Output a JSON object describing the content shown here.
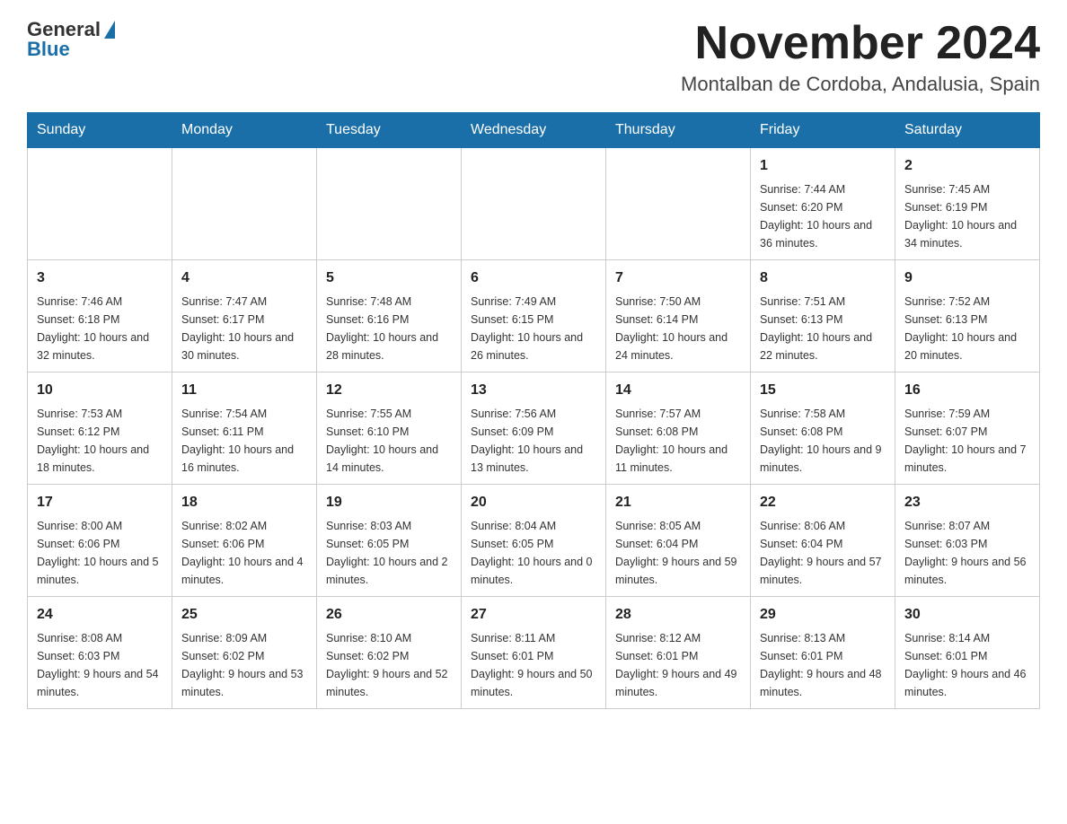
{
  "header": {
    "logo_general": "General",
    "logo_blue": "Blue",
    "month_title": "November 2024",
    "location": "Montalban de Cordoba, Andalusia, Spain"
  },
  "weekdays": [
    "Sunday",
    "Monday",
    "Tuesday",
    "Wednesday",
    "Thursday",
    "Friday",
    "Saturday"
  ],
  "weeks": [
    [
      {
        "day": "",
        "info": ""
      },
      {
        "day": "",
        "info": ""
      },
      {
        "day": "",
        "info": ""
      },
      {
        "day": "",
        "info": ""
      },
      {
        "day": "",
        "info": ""
      },
      {
        "day": "1",
        "info": "Sunrise: 7:44 AM\nSunset: 6:20 PM\nDaylight: 10 hours and 36 minutes."
      },
      {
        "day": "2",
        "info": "Sunrise: 7:45 AM\nSunset: 6:19 PM\nDaylight: 10 hours and 34 minutes."
      }
    ],
    [
      {
        "day": "3",
        "info": "Sunrise: 7:46 AM\nSunset: 6:18 PM\nDaylight: 10 hours and 32 minutes."
      },
      {
        "day": "4",
        "info": "Sunrise: 7:47 AM\nSunset: 6:17 PM\nDaylight: 10 hours and 30 minutes."
      },
      {
        "day": "5",
        "info": "Sunrise: 7:48 AM\nSunset: 6:16 PM\nDaylight: 10 hours and 28 minutes."
      },
      {
        "day": "6",
        "info": "Sunrise: 7:49 AM\nSunset: 6:15 PM\nDaylight: 10 hours and 26 minutes."
      },
      {
        "day": "7",
        "info": "Sunrise: 7:50 AM\nSunset: 6:14 PM\nDaylight: 10 hours and 24 minutes."
      },
      {
        "day": "8",
        "info": "Sunrise: 7:51 AM\nSunset: 6:13 PM\nDaylight: 10 hours and 22 minutes."
      },
      {
        "day": "9",
        "info": "Sunrise: 7:52 AM\nSunset: 6:13 PM\nDaylight: 10 hours and 20 minutes."
      }
    ],
    [
      {
        "day": "10",
        "info": "Sunrise: 7:53 AM\nSunset: 6:12 PM\nDaylight: 10 hours and 18 minutes."
      },
      {
        "day": "11",
        "info": "Sunrise: 7:54 AM\nSunset: 6:11 PM\nDaylight: 10 hours and 16 minutes."
      },
      {
        "day": "12",
        "info": "Sunrise: 7:55 AM\nSunset: 6:10 PM\nDaylight: 10 hours and 14 minutes."
      },
      {
        "day": "13",
        "info": "Sunrise: 7:56 AM\nSunset: 6:09 PM\nDaylight: 10 hours and 13 minutes."
      },
      {
        "day": "14",
        "info": "Sunrise: 7:57 AM\nSunset: 6:08 PM\nDaylight: 10 hours and 11 minutes."
      },
      {
        "day": "15",
        "info": "Sunrise: 7:58 AM\nSunset: 6:08 PM\nDaylight: 10 hours and 9 minutes."
      },
      {
        "day": "16",
        "info": "Sunrise: 7:59 AM\nSunset: 6:07 PM\nDaylight: 10 hours and 7 minutes."
      }
    ],
    [
      {
        "day": "17",
        "info": "Sunrise: 8:00 AM\nSunset: 6:06 PM\nDaylight: 10 hours and 5 minutes."
      },
      {
        "day": "18",
        "info": "Sunrise: 8:02 AM\nSunset: 6:06 PM\nDaylight: 10 hours and 4 minutes."
      },
      {
        "day": "19",
        "info": "Sunrise: 8:03 AM\nSunset: 6:05 PM\nDaylight: 10 hours and 2 minutes."
      },
      {
        "day": "20",
        "info": "Sunrise: 8:04 AM\nSunset: 6:05 PM\nDaylight: 10 hours and 0 minutes."
      },
      {
        "day": "21",
        "info": "Sunrise: 8:05 AM\nSunset: 6:04 PM\nDaylight: 9 hours and 59 minutes."
      },
      {
        "day": "22",
        "info": "Sunrise: 8:06 AM\nSunset: 6:04 PM\nDaylight: 9 hours and 57 minutes."
      },
      {
        "day": "23",
        "info": "Sunrise: 8:07 AM\nSunset: 6:03 PM\nDaylight: 9 hours and 56 minutes."
      }
    ],
    [
      {
        "day": "24",
        "info": "Sunrise: 8:08 AM\nSunset: 6:03 PM\nDaylight: 9 hours and 54 minutes."
      },
      {
        "day": "25",
        "info": "Sunrise: 8:09 AM\nSunset: 6:02 PM\nDaylight: 9 hours and 53 minutes."
      },
      {
        "day": "26",
        "info": "Sunrise: 8:10 AM\nSunset: 6:02 PM\nDaylight: 9 hours and 52 minutes."
      },
      {
        "day": "27",
        "info": "Sunrise: 8:11 AM\nSunset: 6:01 PM\nDaylight: 9 hours and 50 minutes."
      },
      {
        "day": "28",
        "info": "Sunrise: 8:12 AM\nSunset: 6:01 PM\nDaylight: 9 hours and 49 minutes."
      },
      {
        "day": "29",
        "info": "Sunrise: 8:13 AM\nSunset: 6:01 PM\nDaylight: 9 hours and 48 minutes."
      },
      {
        "day": "30",
        "info": "Sunrise: 8:14 AM\nSunset: 6:01 PM\nDaylight: 9 hours and 46 minutes."
      }
    ]
  ]
}
